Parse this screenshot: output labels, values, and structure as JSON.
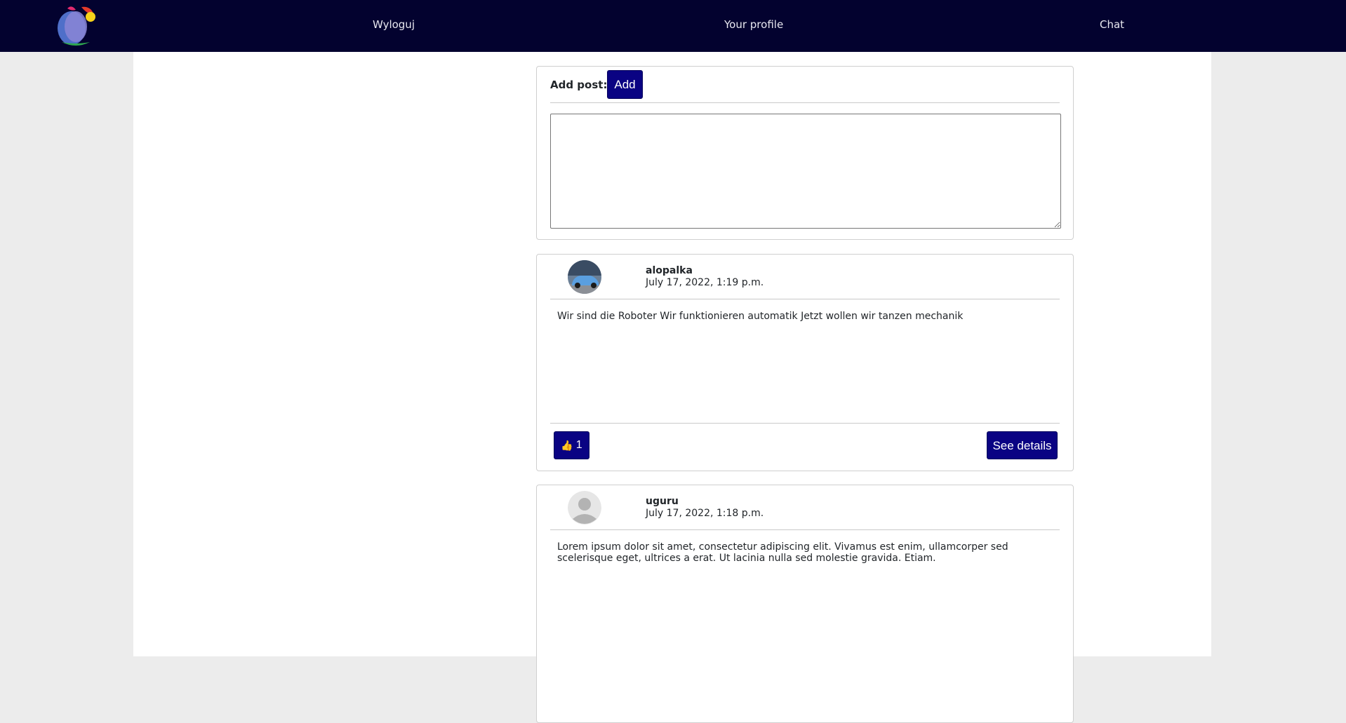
{
  "navbar": {
    "logo_icon": "bt-logo-icon",
    "links": [
      "Wyloguj",
      "Your profile",
      "Chat"
    ]
  },
  "add_post": {
    "label": "Add post:",
    "button_label": "Add",
    "textarea_value": ""
  },
  "posts": [
    {
      "avatar": "car-photo-avatar",
      "username": "alopalka",
      "date": "July 17, 2022, 1:19 p.m.",
      "body": "Wir sind die Roboter Wir funktionieren automatik Jetzt wollen wir tanzen mechanik",
      "like_icon": "thumbs-up-icon",
      "likes": "1",
      "details_label": "See details"
    },
    {
      "avatar": "default-user-avatar",
      "username": "uguru",
      "date": "July 17, 2022, 1:18 p.m.",
      "body": "Lorem ipsum dolor sit amet, consectetur adipiscing elit. Vivamus est enim, ullamcorper sed scelerisque eget, ultrices a erat. Ut lacinia nulla sed molestie gravida. Etiam."
    }
  ],
  "colors": {
    "navbar_bg": "#03022f",
    "button_bg": "#0a0383",
    "page_bg": "#ececec"
  }
}
